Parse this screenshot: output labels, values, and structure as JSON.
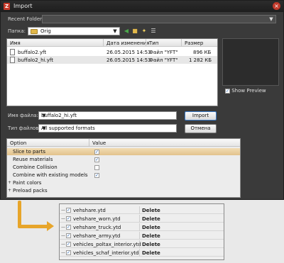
{
  "window": {
    "title": "Import",
    "close_glyph": "×"
  },
  "recent_folders": {
    "label": "Recent Folders:",
    "value": ""
  },
  "folder": {
    "label": "Папка:",
    "value": "Orig"
  },
  "toolbar": {
    "icons": [
      "back-icon",
      "up-folder-icon",
      "new-folder-icon",
      "view-menu-icon"
    ]
  },
  "file_list": {
    "columns": [
      "Имя",
      "Дата изменения",
      "Тип",
      "Размер"
    ],
    "rows": [
      {
        "name": "buffalo2.yft",
        "date": "26.05.2015 14:53",
        "type": "Файл \"YFT\"",
        "size": "896 КБ"
      },
      {
        "name": "buffalo2_hi.yft",
        "date": "26.05.2015 14:53",
        "type": "Файл \"YFT\"",
        "size": "1 282 КБ"
      }
    ],
    "selected_index": 1
  },
  "preview": {
    "show_label": "Show Preview",
    "checked": true
  },
  "file_name": {
    "label": "Имя файла:",
    "value": "buffalo2_hi.yft"
  },
  "file_type": {
    "label": "Тип файлов:",
    "value": "All supported formats"
  },
  "buttons": {
    "import": "Import",
    "cancel": "Отмена"
  },
  "options": {
    "columns": [
      "Option",
      "Value"
    ],
    "rows": [
      {
        "label": "Slice to parts",
        "checked": true,
        "selected": true
      },
      {
        "label": "Reuse materials",
        "checked": true
      },
      {
        "label": "Combine Collision",
        "checked": false
      },
      {
        "label": "Combine with existing models",
        "checked": true
      }
    ],
    "groups": [
      {
        "label": "Paint colors",
        "toggle": "+"
      },
      {
        "label": "Preload packs",
        "toggle": "+"
      }
    ]
  },
  "vehshare": {
    "action_label": "Delete",
    "items": [
      "vehshare.ytd",
      "vehshare_worn.ytd",
      "vehshare_truck.ytd",
      "vehshare_army.ytd",
      "vehicles_poltax_interior.ytd",
      "vehicles_schaf_interior.ytd"
    ]
  },
  "colors": {
    "window_bg": "#3a3a3a",
    "arrow": "#e7a52a",
    "selection": "#e2c28c"
  }
}
